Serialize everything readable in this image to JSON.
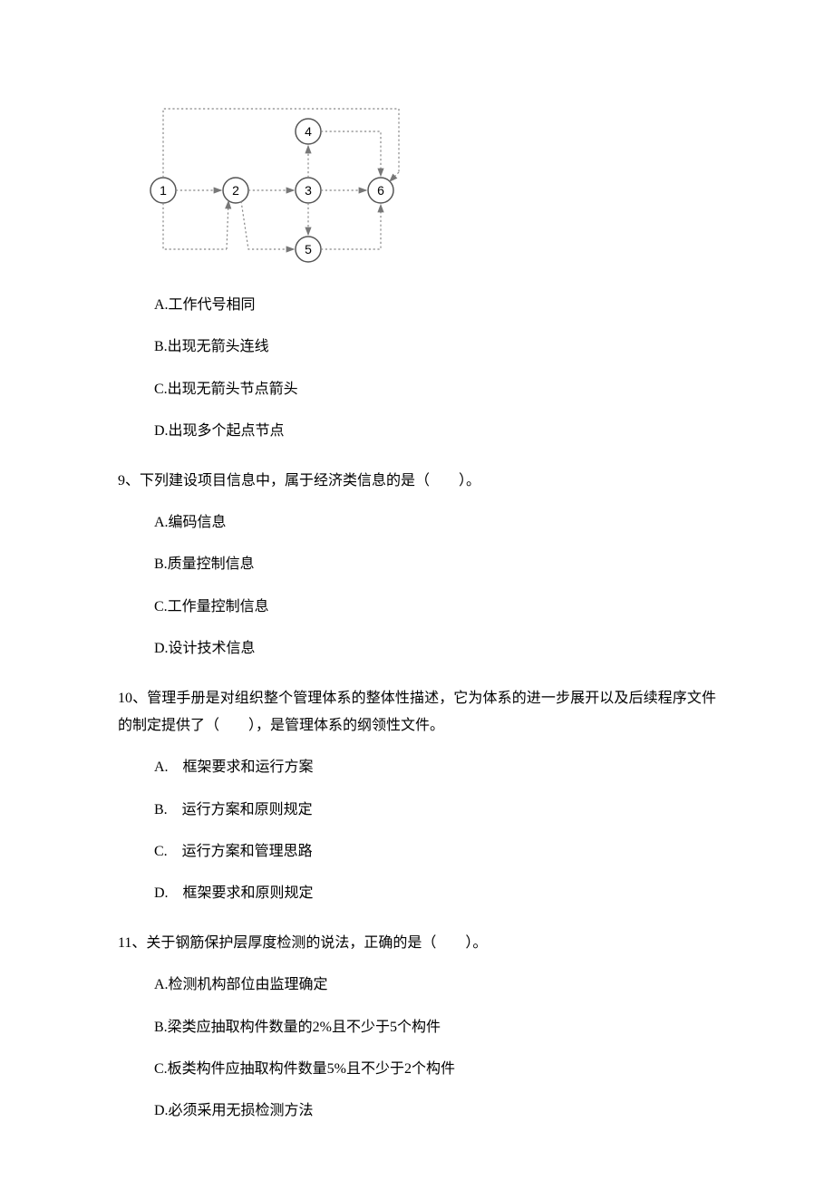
{
  "diagram": {
    "nodes": [
      "1",
      "2",
      "3",
      "4",
      "5",
      "6"
    ]
  },
  "q8": {
    "options": {
      "a": "A.工作代号相同",
      "b": "B.出现无箭头连线",
      "c": "C.出现无箭头节点箭头",
      "d": "D.出现多个起点节点"
    }
  },
  "q9": {
    "stem": "9、下列建设项目信息中，属于经济类信息的是（　　）。",
    "options": {
      "a": "A.编码信息",
      "b": "B.质量控制信息",
      "c": "C.工作量控制信息",
      "d": "D.设计技术信息"
    }
  },
  "q10": {
    "stem": "10、管理手册是对组织整个管理体系的整体性描述，它为体系的进一步展开以及后续程序文件的制定提供了（　　），是管理体系的纲领性文件。",
    "options": {
      "a": "A.　框架要求和运行方案",
      "b": "B.　运行方案和原则规定",
      "c": "C.　运行方案和管理思路",
      "d": "D.　框架要求和原则规定"
    }
  },
  "q11": {
    "stem": "11、关于钢筋保护层厚度检测的说法，正确的是（　　）。",
    "options": {
      "a": "A.检测机构部位由监理确定",
      "b": "B.梁类应抽取构件数量的2%且不少于5个构件",
      "c": "C.板类构件应抽取构件数量5%且不少于2个构件",
      "d": "D.必须采用无损检测方法"
    }
  }
}
